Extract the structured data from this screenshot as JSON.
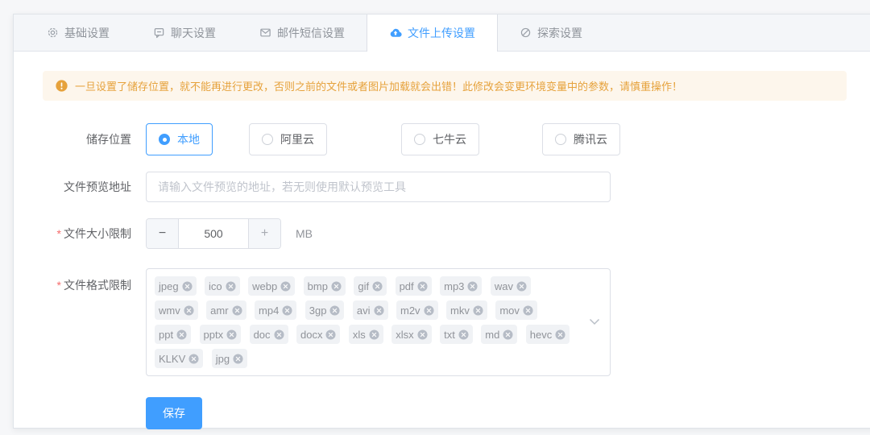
{
  "colors": {
    "accent": "#409EFF",
    "warning_text": "#e6a23c",
    "warning_bg": "#fdf6ec",
    "tag_bg": "#f0f2f5",
    "tab_header_bg": "#f4f6f9"
  },
  "tabs": {
    "items": [
      {
        "label": "基础设置",
        "icon": "gear-icon",
        "active": false
      },
      {
        "label": "聊天设置",
        "icon": "chat-icon",
        "active": false
      },
      {
        "label": "邮件短信设置",
        "icon": "mail-icon",
        "active": false
      },
      {
        "label": "文件上传设置",
        "icon": "cloud-upload-icon",
        "active": true
      },
      {
        "label": "探索设置",
        "icon": "compass-icon",
        "active": false
      }
    ]
  },
  "warning": {
    "icon": "warning-icon",
    "text": "一旦设置了储存位置，就不能再进行更改，否则之前的文件或者图片加载就会出错！此修改会变更环境变量中的参数，请慎重操作！"
  },
  "form": {
    "required_marker": "*",
    "storage": {
      "label": "储存位置",
      "options": [
        {
          "label": "本地",
          "selected": true
        },
        {
          "label": "阿里云",
          "selected": false
        },
        {
          "label": "七牛云",
          "selected": false
        },
        {
          "label": "腾讯云",
          "selected": false
        }
      ]
    },
    "preview": {
      "label": "文件预览地址",
      "value": "",
      "placeholder": "请输入文件预览的地址，若无则使用默认预览工具"
    },
    "size": {
      "label": "文件大小限制",
      "minus": "−",
      "plus": "+",
      "value": "500",
      "unit": "MB"
    },
    "format": {
      "label": "文件格式限制",
      "tags": [
        "jpeg",
        "ico",
        "webp",
        "bmp",
        "gif",
        "pdf",
        "mp3",
        "wav",
        "wmv",
        "amr",
        "mp4",
        "3gp",
        "avi",
        "m2v",
        "mkv",
        "mov",
        "ppt",
        "pptx",
        "doc",
        "docx",
        "xls",
        "xlsx",
        "txt",
        "md",
        "hevc",
        "KLKV",
        "jpg"
      ]
    },
    "save_label": "保存"
  }
}
